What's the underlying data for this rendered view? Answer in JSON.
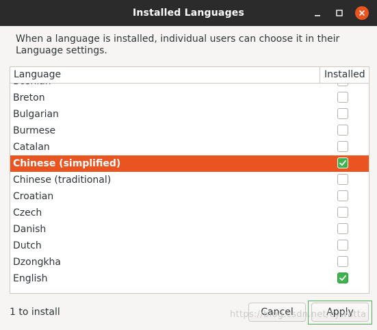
{
  "window": {
    "title": "Installed Languages"
  },
  "description": "When a language is installed, individual users can choose it in their Language settings.",
  "table": {
    "columns": [
      "Language",
      "Installed"
    ],
    "rows": [
      {
        "name": "Bosnian",
        "installed": false,
        "selected": false
      },
      {
        "name": "Breton",
        "installed": false,
        "selected": false
      },
      {
        "name": "Bulgarian",
        "installed": false,
        "selected": false
      },
      {
        "name": "Burmese",
        "installed": false,
        "selected": false
      },
      {
        "name": "Catalan",
        "installed": false,
        "selected": false
      },
      {
        "name": "Chinese (simplified)",
        "installed": true,
        "selected": true
      },
      {
        "name": "Chinese (traditional)",
        "installed": false,
        "selected": false
      },
      {
        "name": "Croatian",
        "installed": false,
        "selected": false
      },
      {
        "name": "Czech",
        "installed": false,
        "selected": false
      },
      {
        "name": "Danish",
        "installed": false,
        "selected": false
      },
      {
        "name": "Dutch",
        "installed": false,
        "selected": false
      },
      {
        "name": "Dzongkha",
        "installed": false,
        "selected": false
      },
      {
        "name": "English",
        "installed": true,
        "selected": false
      }
    ]
  },
  "footer": {
    "status": "1 to install",
    "cancel_label": "Cancel",
    "apply_label": "Apply"
  },
  "watermark": "https://blog.csdn.net/cywatta",
  "colors": {
    "accent": "#e95420",
    "check": "#3eb34f",
    "titlebar": "#2b2b2b"
  }
}
